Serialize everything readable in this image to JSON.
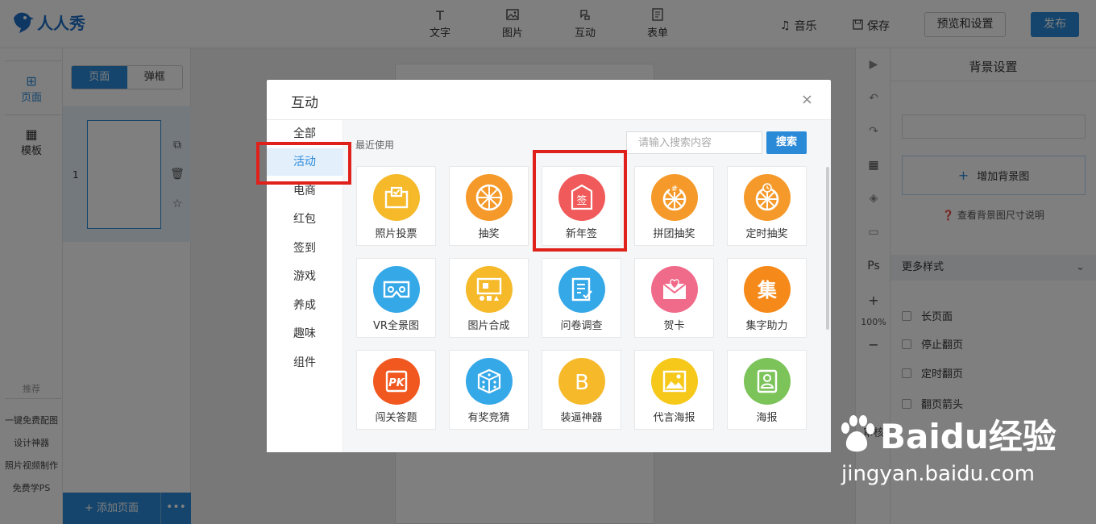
{
  "app": {
    "logo_text": "人人秀",
    "brand_color": "#1d6fc7",
    "accent_color": "#2b8ad8"
  },
  "toolbar": {
    "items": [
      {
        "label": "文字",
        "icon": "T"
      },
      {
        "label": "图片",
        "icon": "image-icon"
      },
      {
        "label": "互动",
        "icon": "interact-icon"
      },
      {
        "label": "表单",
        "icon": "form-icon"
      }
    ],
    "music_label": "音乐",
    "save_label": "保存",
    "preview_label": "预览和设置",
    "publish_label": "发布"
  },
  "rail": {
    "page_label": "页面",
    "template_label": "模板",
    "recommend_label": "推荐",
    "links": [
      "一键免费配图",
      "设计神器",
      "照片视频制作",
      "免费学PS"
    ]
  },
  "pages": {
    "tabs": [
      "页面",
      "弹框"
    ],
    "active_tab": 0,
    "page_numbers": [
      "1"
    ],
    "add_page_label": "+ 添加页面",
    "more_label": "•••"
  },
  "right_tools": {
    "zoom_label": "100%",
    "review_label": "审核",
    "ps_label": "Ps"
  },
  "settings": {
    "title": "背景设置",
    "add_bg_label": "增加背景图",
    "help_label": "查看背景图尺寸说明",
    "more_styles_label": "更多样式",
    "options": [
      "长页面",
      "停止翻页",
      "定时翻页",
      "翻页箭头"
    ]
  },
  "modal": {
    "title": "互动",
    "close": "×",
    "categories": [
      "全部",
      "活动",
      "电商",
      "红包",
      "签到",
      "游戏",
      "养成",
      "趣味",
      "组件"
    ],
    "active_category": 1,
    "recent_label": "最近使用",
    "search_placeholder": "请输入搜索内容",
    "search_button": "搜索",
    "items": [
      {
        "label": "照片投票",
        "color": "#f5b92a",
        "icon": "photo-vote-icon"
      },
      {
        "label": "抽奖",
        "color": "#f59a2a",
        "icon": "wheel-icon"
      },
      {
        "label": "新年签",
        "color": "#f05a5a",
        "icon": "new-year-sign-icon"
      },
      {
        "label": "拼团抽奖",
        "color": "#f59a2a",
        "icon": "group-wheel-icon"
      },
      {
        "label": "定时抽奖",
        "color": "#f59a2a",
        "icon": "timed-wheel-icon"
      },
      {
        "label": "VR全景图",
        "color": "#35a8e8",
        "icon": "vr-icon"
      },
      {
        "label": "图片合成",
        "color": "#f5b92a",
        "icon": "image-compose-icon"
      },
      {
        "label": "问卷调查",
        "color": "#35a8e8",
        "icon": "survey-icon"
      },
      {
        "label": "贺卡",
        "color": "#f06a8a",
        "icon": "greeting-card-icon"
      },
      {
        "label": "集字助力",
        "color": "#f58a1a",
        "icon": "collect-char-icon"
      },
      {
        "label": "闯关答题",
        "color": "#f0581f",
        "icon": "pk-quiz-icon"
      },
      {
        "label": "有奖竞猜",
        "color": "#35a8e8",
        "icon": "dice-icon"
      },
      {
        "label": "装逼神器",
        "color": "#f5b92a",
        "icon": "b-icon"
      },
      {
        "label": "代言海报",
        "color": "#f5c81a",
        "icon": "poster-icon"
      },
      {
        "label": "海报",
        "color": "#7cc35a",
        "icon": "poster-person-icon"
      }
    ]
  },
  "watermark": {
    "brand": "Baidu经验",
    "url": "jingyan.baidu.com"
  }
}
